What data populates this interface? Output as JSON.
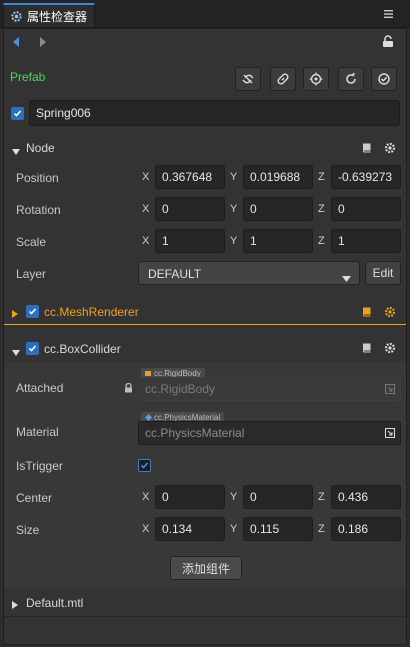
{
  "tab": {
    "title": "属性检查器",
    "icon": "inspector-gear-icon"
  },
  "header": {
    "prefab_label": "Prefab",
    "accent": "#56d456"
  },
  "node_name": "Spring006",
  "node_section": {
    "title": "Node"
  },
  "transform": {
    "position": {
      "label": "Position",
      "x": "0.367648",
      "y": "0.019688",
      "z": "-0.639273"
    },
    "rotation": {
      "label": "Rotation",
      "x": "0",
      "y": "0",
      "z": "0"
    },
    "scale": {
      "label": "Scale",
      "x": "1",
      "y": "1",
      "z": "1"
    },
    "axis_x": "X",
    "axis_y": "Y",
    "axis_z": "Z"
  },
  "layer": {
    "label": "Layer",
    "value": "DEFAULT",
    "edit_label": "Edit"
  },
  "mesh_renderer": {
    "title": "cc.MeshRenderer",
    "color": "#f0a020"
  },
  "box_collider": {
    "title": "cc.BoxCollider",
    "attached": {
      "label": "Attached",
      "tag": "cc.RigidBody",
      "value": "cc.RigidBody"
    },
    "material": {
      "label": "Material",
      "tag": "cc.PhysicsMaterial",
      "value": "cc.PhysicsMaterial"
    },
    "is_trigger": {
      "label": "IsTrigger"
    },
    "center": {
      "label": "Center",
      "x": "0",
      "y": "0",
      "z": "0.436"
    },
    "size": {
      "label": "Size",
      "x": "0.134",
      "y": "0.115",
      "z": "0.186"
    }
  },
  "add_component_label": "添加组件",
  "material_section": {
    "title": "Default.mtl"
  }
}
